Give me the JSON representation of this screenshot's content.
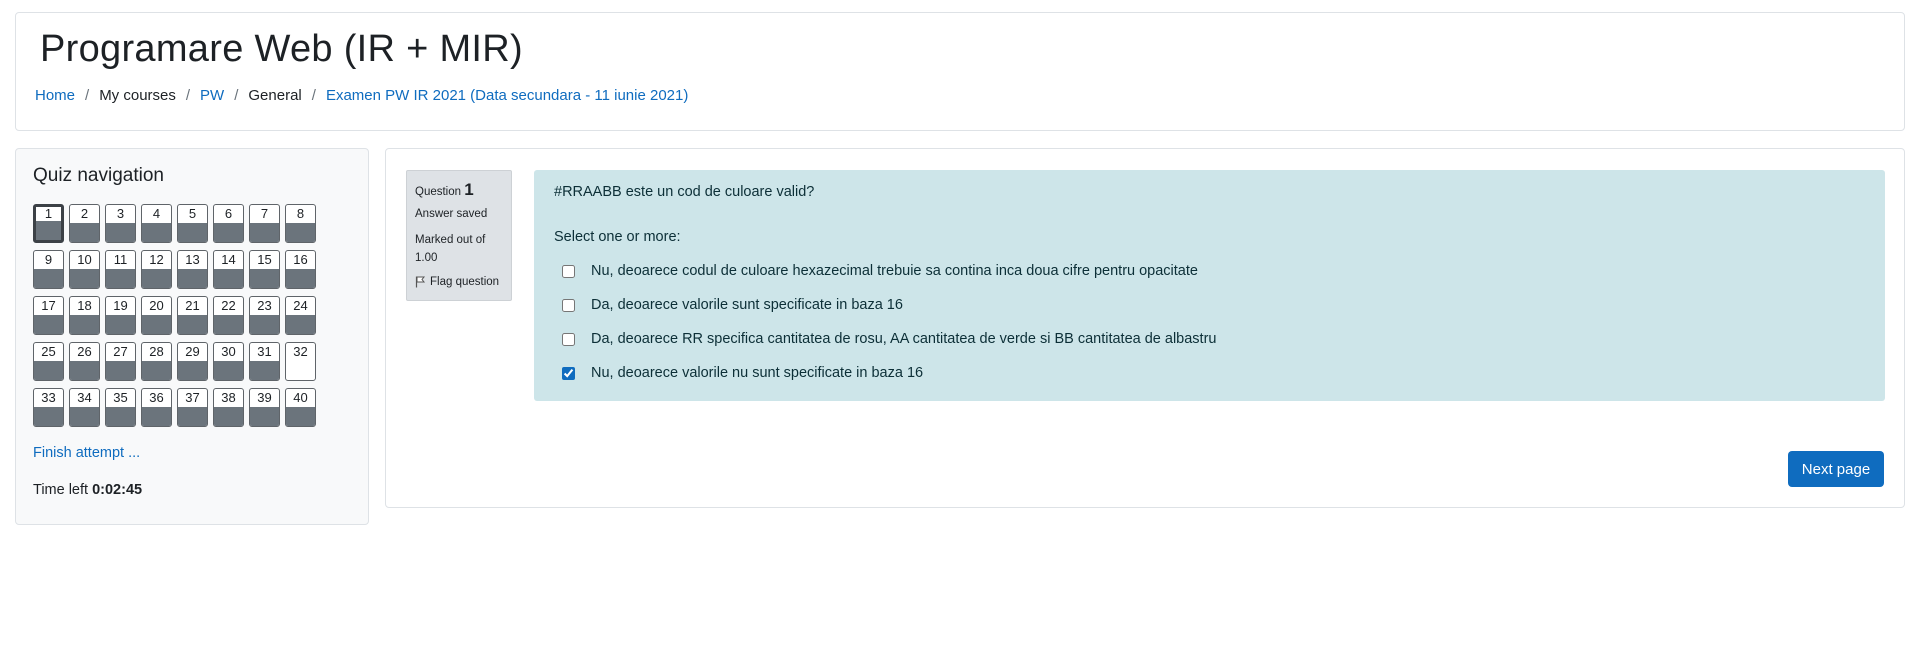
{
  "header": {
    "title": "Programare Web (IR + MIR)",
    "breadcrumb": [
      "Home",
      "My courses",
      "PW",
      "General",
      "Examen PW IR 2021 (Data secundara - 11 iunie 2021)"
    ]
  },
  "quiz_nav": {
    "title": "Quiz navigation",
    "questions": [
      {
        "n": "1",
        "answered": true,
        "current": true
      },
      {
        "n": "2",
        "answered": true
      },
      {
        "n": "3",
        "answered": true
      },
      {
        "n": "4",
        "answered": true
      },
      {
        "n": "5",
        "answered": true
      },
      {
        "n": "6",
        "answered": true
      },
      {
        "n": "7",
        "answered": true
      },
      {
        "n": "8",
        "answered": true
      },
      {
        "n": "9",
        "answered": true
      },
      {
        "n": "10",
        "answered": true
      },
      {
        "n": "11",
        "answered": true
      },
      {
        "n": "12",
        "answered": true
      },
      {
        "n": "13",
        "answered": true
      },
      {
        "n": "14",
        "answered": true
      },
      {
        "n": "15",
        "answered": true
      },
      {
        "n": "16",
        "answered": true
      },
      {
        "n": "17",
        "answered": true
      },
      {
        "n": "18",
        "answered": true
      },
      {
        "n": "19",
        "answered": true
      },
      {
        "n": "20",
        "answered": true
      },
      {
        "n": "21",
        "answered": true
      },
      {
        "n": "22",
        "answered": true
      },
      {
        "n": "23",
        "answered": true
      },
      {
        "n": "24",
        "answered": true
      },
      {
        "n": "25",
        "answered": true
      },
      {
        "n": "26",
        "answered": true
      },
      {
        "n": "27",
        "answered": true
      },
      {
        "n": "28",
        "answered": true
      },
      {
        "n": "29",
        "answered": true
      },
      {
        "n": "30",
        "answered": true
      },
      {
        "n": "31",
        "answered": true
      },
      {
        "n": "32",
        "answered": false
      },
      {
        "n": "33",
        "answered": true
      },
      {
        "n": "34",
        "answered": true
      },
      {
        "n": "35",
        "answered": true
      },
      {
        "n": "36",
        "answered": true
      },
      {
        "n": "37",
        "answered": true
      },
      {
        "n": "38",
        "answered": true
      },
      {
        "n": "39",
        "answered": true
      },
      {
        "n": "40",
        "answered": true
      }
    ],
    "finish_label": "Finish attempt ...",
    "time_left_label": "Time left",
    "time_left_value": "0:02:45"
  },
  "question": {
    "label": "Question",
    "number": "1",
    "state": "Answer saved",
    "grade_label": "Marked out of",
    "grade_value": "1.00",
    "flag_label": "Flag question",
    "text": "#RRAABB este un cod de culoare valid?",
    "prompt": "Select one or more:",
    "answers": [
      {
        "label": "Nu, deoarece codul de culoare hexazecimal trebuie sa contina inca doua cifre pentru opacitate",
        "checked": false
      },
      {
        "label": "Da, deoarece valorile sunt specificate in baza 16",
        "checked": false
      },
      {
        "label": "Da, deoarece RR specifica cantitatea de rosu, AA cantitatea de verde si BB cantitatea de albastru",
        "checked": false
      },
      {
        "label": "Nu, deoarece valorile nu sunt specificate in baza 16",
        "checked": true
      }
    ]
  },
  "next_label": "Next page",
  "colors": {
    "link": "#0f6cbf",
    "answered_fill": "#6b747c",
    "question_bg": "#cde5e9"
  }
}
